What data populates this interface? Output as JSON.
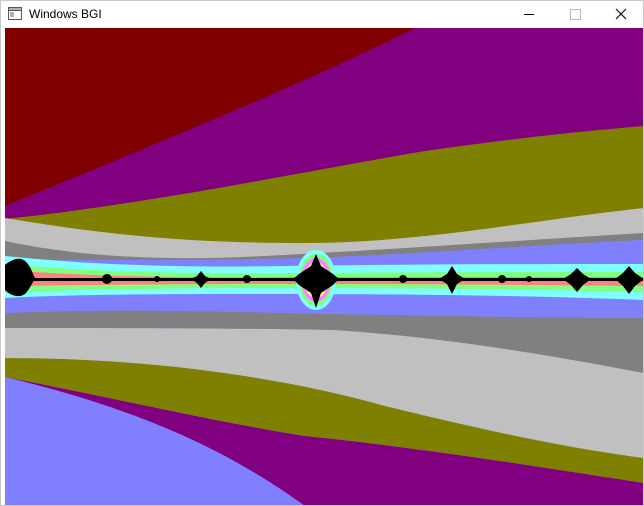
{
  "window": {
    "title": "Windows BGI",
    "controls": {
      "minimize": "minimize-icon",
      "maximize": "maximize-icon",
      "close": "close-icon"
    }
  },
  "canvas": {
    "palette": {
      "dark_red": "#800000",
      "purple": "#800080",
      "olive": "#808000",
      "light_gray": "#c0c0c0",
      "dark_gray": "#808080",
      "light_blue": "#8080ff",
      "light_cyan": "#80ffff",
      "light_green": "#80ff80",
      "light_red": "#ff8080",
      "light_magenta": "#ff80ff",
      "yellow": "#ffff80",
      "white": "#ffffff",
      "black": "#000000"
    }
  }
}
